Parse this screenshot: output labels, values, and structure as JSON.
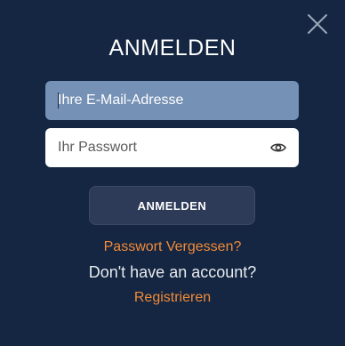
{
  "modal": {
    "title": "ANMELDEN",
    "close_icon": "close-icon"
  },
  "form": {
    "email": {
      "placeholder": "Ihre E-Mail-Adresse",
      "value": ""
    },
    "password": {
      "placeholder": "Ihr Passwort",
      "value": "",
      "toggle_icon": "eye-icon"
    },
    "submit_label": "ANMELDEN"
  },
  "links": {
    "forgot_password": "Passwort Vergessen?",
    "no_account_text": "Don't have an account?",
    "register": "Registrieren"
  },
  "colors": {
    "background": "#142641",
    "email_field_focused": "#7591b5",
    "accent_link": "#f28a38",
    "button_bg": "#2d3a58"
  }
}
